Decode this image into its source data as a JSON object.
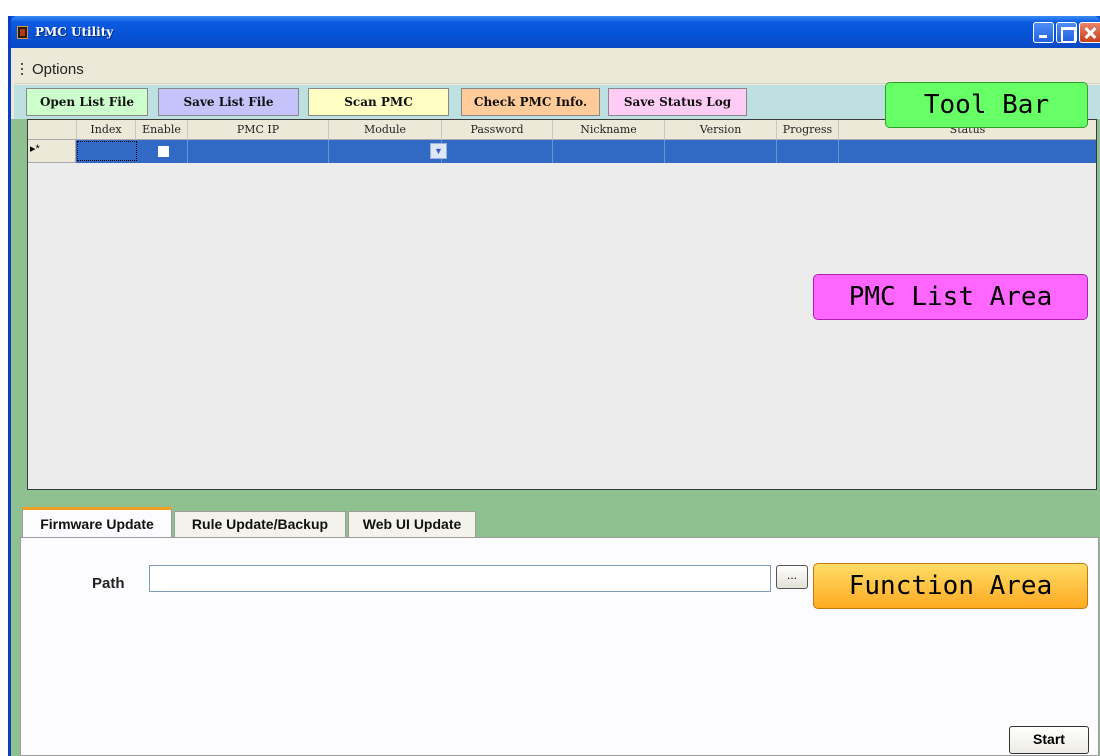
{
  "window": {
    "title": "PMC Utility"
  },
  "menu": {
    "options_label": "Options"
  },
  "toolbar": {
    "buttons": [
      {
        "label": "Open List File",
        "color": "#ccffcc"
      },
      {
        "label": "Save List File",
        "color": "#c4c4fa"
      },
      {
        "label": "Scan PMC",
        "color": "#ffffc4"
      },
      {
        "label": "Check PMC Info.",
        "color": "#ffcc99"
      },
      {
        "label": "Save Status Log",
        "color": "#ffccf5"
      }
    ]
  },
  "grid": {
    "columns": [
      "Index",
      "Enable",
      "PMC IP",
      "Module",
      "Password",
      "Nickname",
      "Version",
      "Progress",
      "Status"
    ],
    "new_row_marker": "▸*",
    "selection_color": "#316ac5"
  },
  "tabs": [
    {
      "label": "Firmware Update",
      "active": true
    },
    {
      "label": "Rule Update/Backup",
      "active": false
    },
    {
      "label": "Web UI Update",
      "active": false
    }
  ],
  "function": {
    "path_label": "Path",
    "path_value": "",
    "browse_label": "...",
    "start_label": "Start"
  },
  "callouts": {
    "toolbar": {
      "text": "Tool Bar",
      "color": "#66ff66"
    },
    "list": {
      "text": "PMC List Area",
      "color": "#ff66ff"
    },
    "function": {
      "text": "Function Area",
      "color": "#ffcc44"
    }
  }
}
